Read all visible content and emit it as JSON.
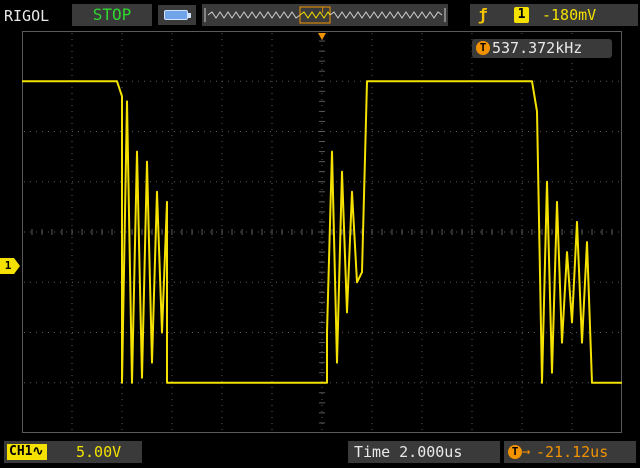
{
  "header": {
    "brand": "RIGOL",
    "run_state": "STOP",
    "memory_icon": "memory-depth-icon",
    "trigger": {
      "edge_icon": "rising-edge-icon",
      "edge_glyph": "ƒ",
      "source": "1",
      "level": "-180mV"
    }
  },
  "overview": {
    "trigger_marker": "T"
  },
  "measurement": {
    "icon": "T",
    "frequency": "537.372kHz"
  },
  "channel": {
    "marker": "1",
    "name": "CH1",
    "coupling_icon": "∿",
    "scale": "5.00V"
  },
  "timebase": {
    "label": "Time",
    "value": "2.000us",
    "display": "Time 2.000us"
  },
  "delay": {
    "icon": "T",
    "arrow": "→",
    "value": "-21.12us"
  },
  "colors": {
    "background": "#000000",
    "trace": "#f4e100",
    "grid": "#5a5a5a",
    "panel": "#3a3a3a",
    "run_state": "#30d630",
    "accent": "#f39200",
    "text": "#e9e9e9"
  },
  "chart_data": {
    "type": "line",
    "title": "",
    "xlabel": "",
    "ylabel": "",
    "grid": true,
    "x_divisions": 12,
    "y_divisions": 8,
    "x_units": "div",
    "y_units": "div",
    "xlim": [
      0,
      12
    ],
    "ylim": [
      -4,
      4
    ],
    "series": [
      {
        "color": "#f4e100",
        "description_points": [
          [
            0.0,
            3.0
          ],
          [
            1.9,
            3.0
          ],
          [
            2.0,
            2.7
          ],
          [
            2.0,
            -3.0
          ],
          [
            2.1,
            2.6
          ],
          [
            2.2,
            -3.0
          ],
          [
            2.3,
            1.6
          ],
          [
            2.4,
            -2.9
          ],
          [
            2.5,
            1.4
          ],
          [
            2.6,
            -2.6
          ],
          [
            2.7,
            0.8
          ],
          [
            2.8,
            -2.0
          ],
          [
            2.9,
            0.6
          ],
          [
            2.9,
            -3.0
          ],
          [
            6.1,
            -3.0
          ],
          [
            6.1,
            -2.0
          ],
          [
            6.2,
            1.6
          ],
          [
            6.3,
            -2.6
          ],
          [
            6.4,
            1.2
          ],
          [
            6.5,
            -1.6
          ],
          [
            6.6,
            0.8
          ],
          [
            6.7,
            -1.0
          ],
          [
            6.8,
            -0.8
          ],
          [
            6.9,
            3.0
          ],
          [
            10.2,
            3.0
          ],
          [
            10.3,
            2.4
          ],
          [
            10.4,
            -3.0
          ],
          [
            10.5,
            1.0
          ],
          [
            10.6,
            -2.8
          ],
          [
            10.7,
            0.6
          ],
          [
            10.8,
            -2.2
          ],
          [
            10.9,
            -0.4
          ],
          [
            11.0,
            -1.8
          ],
          [
            11.1,
            0.2
          ],
          [
            11.2,
            -2.2
          ],
          [
            11.3,
            -0.2
          ],
          [
            11.4,
            -3.0
          ],
          [
            12.0,
            -3.0
          ]
        ]
      }
    ]
  }
}
